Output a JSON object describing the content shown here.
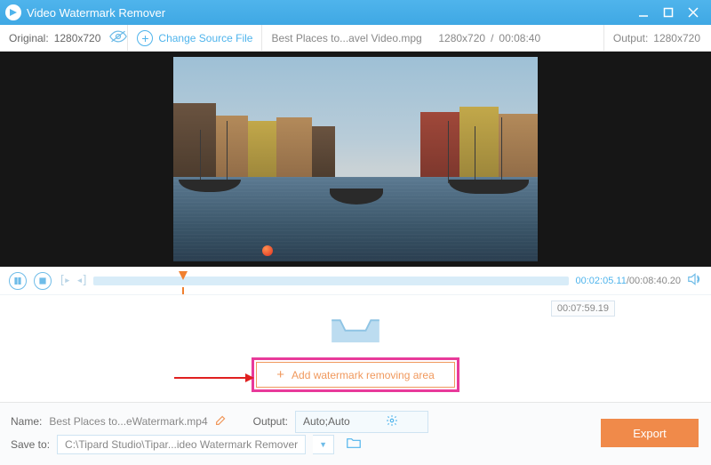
{
  "titlebar": {
    "title": "Video Watermark Remover"
  },
  "toolbar": {
    "original_label": "Original:",
    "original_res": "1280x720",
    "change_source": "Change Source File",
    "filename": "Best Places to...avel Video.mpg",
    "fileres": "1280x720",
    "fileduration": "00:08:40",
    "output_label": "Output:",
    "output_res": "1280x720"
  },
  "playback": {
    "current": "00:02:05.11",
    "total": "00:08:40.20"
  },
  "tray": {
    "timestamp": "00:07:59.19",
    "add_button": "Add watermark removing area"
  },
  "bottom": {
    "name_label": "Name:",
    "name_value": "Best Places to...eWatermark.mp4",
    "output_label": "Output:",
    "output_value": "Auto;Auto",
    "saveto_label": "Save to:",
    "saveto_value": "C:\\Tipard Studio\\Tipar...ideo Watermark Remover",
    "export": "Export"
  }
}
